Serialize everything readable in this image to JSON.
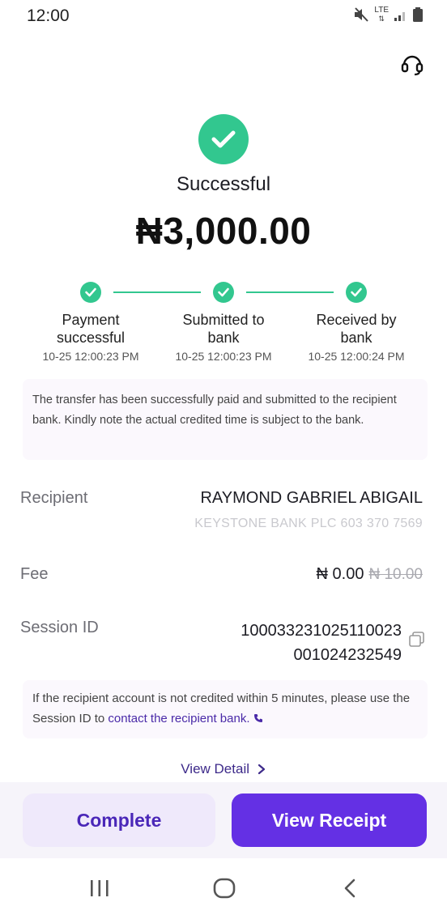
{
  "status_bar": {
    "time": "12:00",
    "network": "LTE"
  },
  "header": {
    "support_icon": "headset-icon"
  },
  "transaction": {
    "status": "Successful",
    "amount": "₦3,000.00"
  },
  "steps": [
    {
      "label": "Payment successful",
      "time": "10-25 12:00:23 PM"
    },
    {
      "label": "Submitted to bank",
      "time": "10-25 12:00:23 PM"
    },
    {
      "label": "Received by bank",
      "time": "10-25 12:00:24 PM"
    }
  ],
  "info_text": "The transfer has been successfully paid and submitted to the recipient bank. Kindly note the actual credited time is subject to the bank.",
  "details": {
    "recipient_label": "Recipient",
    "recipient_name": "RAYMOND GABRIEL ABIGAIL",
    "recipient_bank": "KEYSTONE BANK PLC 603 370 7569",
    "fee_label": "Fee",
    "fee_value": "₦ 0.00",
    "fee_original": "₦ 10.00",
    "session_label": "Session ID",
    "session_id": "100033231025110023001024232549"
  },
  "note": {
    "text": "If the recipient account is not credited within 5 minutes, please use the Session ID to ",
    "link": "contact the recipient bank."
  },
  "view_detail": "View Detail",
  "buttons": {
    "complete": "Complete",
    "view_receipt": "View Receipt"
  },
  "colors": {
    "success": "#32c78f",
    "primary": "#6430e4",
    "link": "#4a2aa8"
  }
}
